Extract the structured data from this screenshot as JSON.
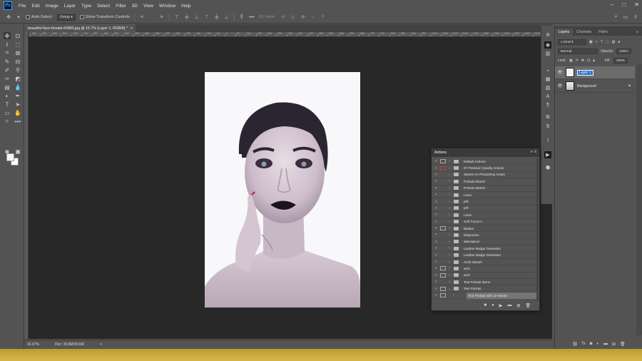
{
  "menu": {
    "logo": "Ps",
    "items": [
      "File",
      "Edit",
      "Image",
      "Layer",
      "Type",
      "Select",
      "Filter",
      "3D",
      "View",
      "Window",
      "Help"
    ]
  },
  "window_controls": [
    "–",
    "□",
    "✕"
  ],
  "options": {
    "auto_select_label": "Auto-Select:",
    "auto_select_value": "Group",
    "transform_label": "Show Transform Controls",
    "mode_3d_label": "3D Mode:"
  },
  "document_tab": {
    "title": "beautiful-face-female-60883.jpg @ 16.7% (Layer 1, RGB/8) *",
    "close": "×"
  },
  "ruler_numbers": [
    "-950",
    "-900",
    "-850",
    "-800",
    "-750",
    "-700",
    "-650",
    "-600",
    "-550",
    "-500",
    "-450",
    "-400",
    "-350",
    "-300",
    "-250",
    "-200",
    "-150",
    "-100",
    "-50",
    "0",
    "50",
    "100",
    "150",
    "200",
    "250",
    "300",
    "350",
    "400",
    "450",
    "500",
    "550",
    "600",
    "650",
    "700",
    "750",
    "800",
    "850",
    "900",
    "950",
    "1000",
    "1050",
    "1100",
    "1150",
    "1200",
    "1250",
    "1300",
    "1350",
    "1400",
    "1450",
    "1500",
    "1550"
  ],
  "status": {
    "zoom": "16.67%",
    "doc": "Doc: 33.6M/33.6M",
    "arrow": ">"
  },
  "layers_panel": {
    "tabs": [
      "Layers",
      "Channels",
      "Paths"
    ],
    "kind_label": "Kind",
    "blend_mode": "Normal",
    "opacity_label": "Opacity:",
    "opacity_value": "100%",
    "lock_label": "Lock:",
    "fill_label": "Fill:",
    "fill_value": "100%",
    "layers": [
      {
        "name": "Layer 1",
        "selected": true,
        "editing": true
      },
      {
        "name": "Background",
        "selected": false,
        "locked": true
      }
    ]
  },
  "actions_panel": {
    "title": "Actions",
    "collapse": "»",
    "menu": "≡",
    "items": [
      {
        "name": "Default Actions",
        "dialog": "box",
        "expanded": false,
        "type": "set"
      },
      {
        "name": "67 Premium Quality Actions",
        "dialog": "red",
        "expanded": false,
        "type": "set"
      },
      {
        "name": "Sketch Art Photoshop Action",
        "dialog": "none",
        "expanded": false,
        "type": "set"
      },
      {
        "name": "Portrait Sketch",
        "dialog": "none",
        "expanded": false,
        "type": "set"
      },
      {
        "name": "Portrait Sketch",
        "dialog": "none",
        "expanded": false,
        "type": "set"
      },
      {
        "name": "Lines",
        "dialog": "none",
        "expanded": false,
        "type": "set"
      },
      {
        "name": "prft",
        "dialog": "none",
        "expanded": false,
        "type": "set"
      },
      {
        "name": "prft",
        "dialog": "none",
        "expanded": false,
        "type": "set"
      },
      {
        "name": "Lines",
        "dialog": "none",
        "expanded": false,
        "type": "set"
      },
      {
        "name": "Soft Focus 2",
        "dialog": "none",
        "expanded": false,
        "type": "set"
      },
      {
        "name": "Blades",
        "dialog": "box",
        "expanded": false,
        "type": "set"
      },
      {
        "name": "Dispersion",
        "dialog": "none",
        "expanded": false,
        "type": "set"
      },
      {
        "name": "alanvapour",
        "dialog": "none",
        "expanded": false,
        "type": "set"
      },
      {
        "name": "Leather Badge Generator",
        "dialog": "none",
        "expanded": false,
        "type": "set"
      },
      {
        "name": "Leather Badge Generator",
        "dialog": "none",
        "expanded": false,
        "type": "set"
      },
      {
        "name": "Archi Sketch",
        "dialog": "none",
        "expanded": false,
        "type": "set"
      },
      {
        "name": "arcit",
        "dialog": "box",
        "expanded": false,
        "type": "set"
      },
      {
        "name": "arcit",
        "dialog": "box",
        "expanded": false,
        "type": "set"
      },
      {
        "name": "Text Portrait demo",
        "dialog": "none",
        "expanded": false,
        "type": "set"
      },
      {
        "name": "Text Portrait",
        "dialog": "box",
        "expanded": true,
        "type": "set"
      },
      {
        "name": "Text Portrait with 10 Words",
        "dialog": "box",
        "expanded": false,
        "type": "action",
        "selected": true
      }
    ],
    "footer_icons": [
      "stop-icon",
      "record-icon",
      "play-icon",
      "new-set-icon",
      "new-action-icon",
      "delete-icon"
    ]
  },
  "colors": {
    "ui_panel": "#535353",
    "canvas_bg": "#282828",
    "accent_blue": "#31a8ff",
    "taskbar_gold": "#c9a93f"
  }
}
